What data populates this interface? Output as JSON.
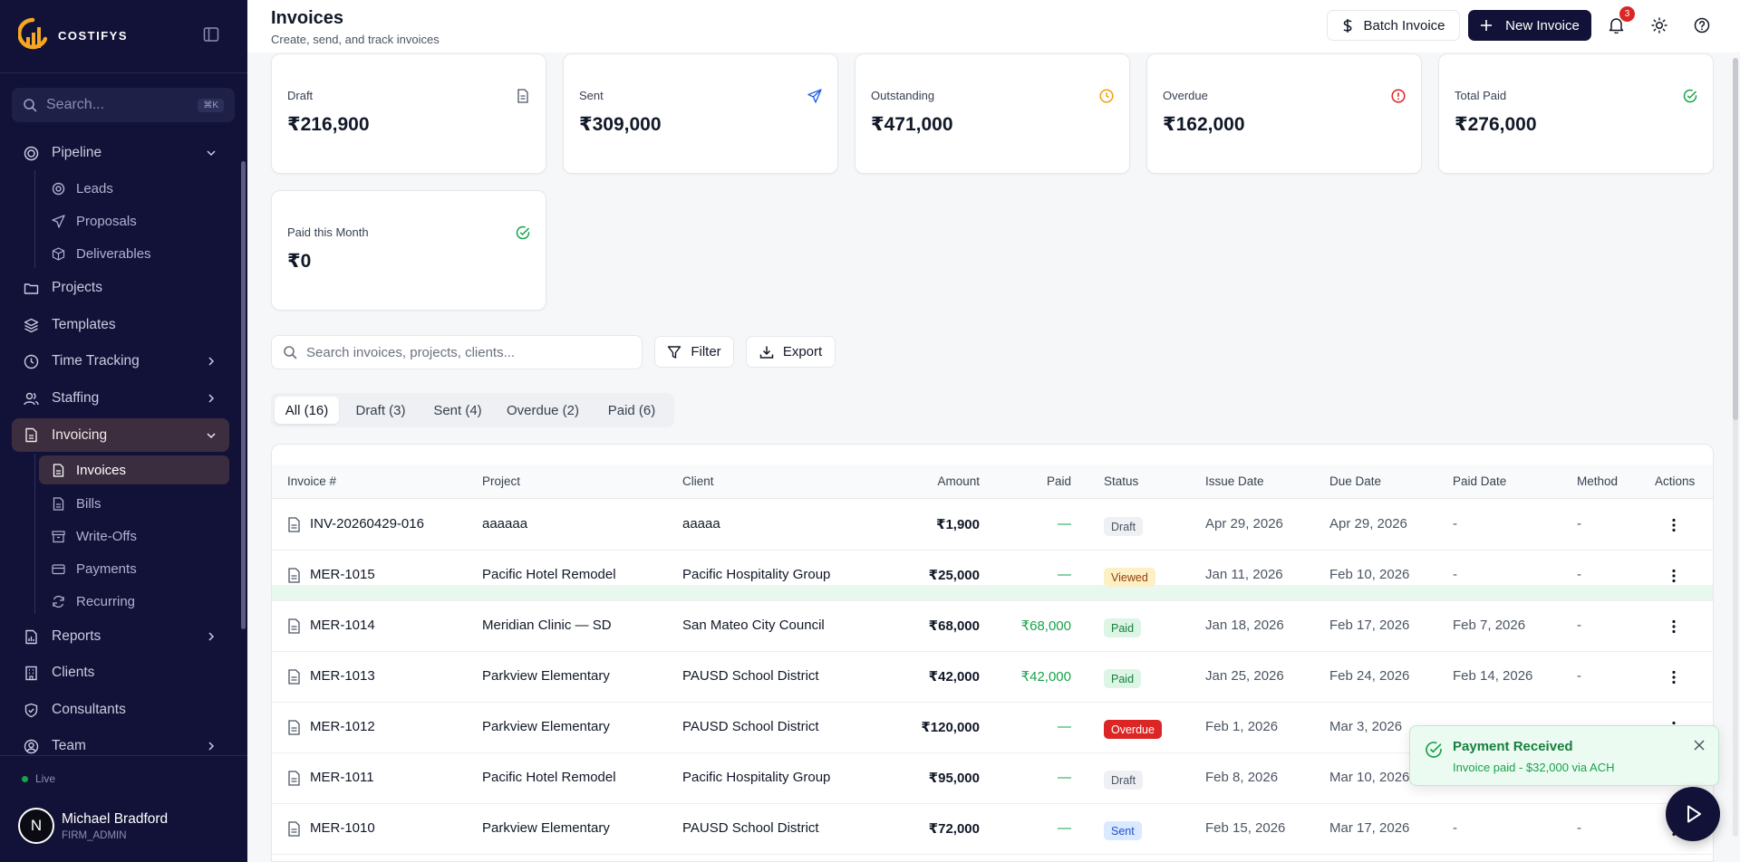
{
  "brand": {
    "name": "COSTIFYS"
  },
  "sidebar": {
    "search_placeholder": "Search...",
    "search_shortcut": "⌘K",
    "items": [
      {
        "label": "Pipeline"
      },
      {
        "label": "Leads"
      },
      {
        "label": "Proposals"
      },
      {
        "label": "Deliverables"
      },
      {
        "label": "Projects"
      },
      {
        "label": "Templates"
      },
      {
        "label": "Time Tracking"
      },
      {
        "label": "Staffing"
      },
      {
        "label": "Invoicing"
      },
      {
        "label": "Invoices"
      },
      {
        "label": "Bills"
      },
      {
        "label": "Write-Offs"
      },
      {
        "label": "Payments"
      },
      {
        "label": "Recurring"
      },
      {
        "label": "Reports"
      },
      {
        "label": "Clients"
      },
      {
        "label": "Consultants"
      },
      {
        "label": "Team"
      }
    ],
    "status": "Live",
    "user": {
      "initial": "N",
      "name": "Michael Bradford",
      "role": "FIRM_ADMIN"
    }
  },
  "header": {
    "title": "Invoices",
    "subtitle": "Create, send, and track invoices",
    "batch_label": "Batch Invoice",
    "new_label": "New Invoice",
    "notification_count": "3"
  },
  "cards": [
    {
      "label": "Draft",
      "value": "₹216,900"
    },
    {
      "label": "Sent",
      "value": "₹309,000"
    },
    {
      "label": "Outstanding",
      "value": "₹471,000"
    },
    {
      "label": "Overdue",
      "value": "₹162,000"
    },
    {
      "label": "Total Paid",
      "value": "₹276,000"
    },
    {
      "label": "Paid this Month",
      "value": "₹0"
    }
  ],
  "toolbar": {
    "search_placeholder": "Search invoices, projects, clients...",
    "filter_label": "Filter",
    "export_label": "Export"
  },
  "tabs": [
    "All (16)",
    "Draft (3)",
    "Sent (4)",
    "Overdue (2)",
    "Paid (6)"
  ],
  "table": {
    "headers": [
      "Invoice #",
      "Project",
      "Client",
      "Amount",
      "Paid",
      "Status",
      "Issue Date",
      "Due Date",
      "Paid Date",
      "Method",
      "Actions"
    ],
    "rows": [
      {
        "invoice": "INV-20260429-016",
        "project": "aaaaaa",
        "client": "aaaaa",
        "amount": "₹1,900",
        "paid": "—",
        "status": "Draft",
        "issue": "Apr 29, 2026",
        "due": "Apr 29, 2026",
        "paid_date": "-",
        "method": "-"
      },
      {
        "invoice": "MER-1015",
        "project": "Pacific Hotel Remodel",
        "client": "Pacific Hospitality Group",
        "amount": "₹25,000",
        "paid": "—",
        "status": "Viewed",
        "issue": "Jan 11, 2026",
        "due": "Feb 10, 2026",
        "paid_date": "-",
        "method": "-"
      },
      {
        "invoice": "MER-1014",
        "project": "Meridian Clinic — SD",
        "client": "San Mateo City Council",
        "amount": "₹68,000",
        "paid": "₹68,000",
        "status": "Paid",
        "issue": "Jan 18, 2026",
        "due": "Feb 17, 2026",
        "paid_date": "Feb 7, 2026",
        "method": "-"
      },
      {
        "invoice": "MER-1013",
        "project": "Parkview Elementary",
        "client": "PAUSD School District",
        "amount": "₹42,000",
        "paid": "₹42,000",
        "status": "Paid",
        "issue": "Jan 25, 2026",
        "due": "Feb 24, 2026",
        "paid_date": "Feb 14, 2026",
        "method": "-"
      },
      {
        "invoice": "MER-1012",
        "project": "Parkview Elementary",
        "client": "PAUSD School District",
        "amount": "₹120,000",
        "paid": "—",
        "status": "Overdue",
        "issue": "Feb 1, 2026",
        "due": "Mar 3, 2026",
        "paid_date": "",
        "method": ""
      },
      {
        "invoice": "MER-1011",
        "project": "Pacific Hotel Remodel",
        "client": "Pacific Hospitality Group",
        "amount": "₹95,000",
        "paid": "—",
        "status": "Draft",
        "issue": "Feb 8, 2026",
        "due": "Mar 10, 2026",
        "paid_date": "",
        "method": ""
      },
      {
        "invoice": "MER-1010",
        "project": "Parkview Elementary",
        "client": "PAUSD School District",
        "amount": "₹72,000",
        "paid": "—",
        "status": "Sent",
        "issue": "Feb 15, 2026",
        "due": "Mar 17, 2026",
        "paid_date": "-",
        "method": "-"
      }
    ]
  },
  "toast": {
    "title": "Payment Received",
    "message": "Invoice paid - $32,000 via ACH"
  },
  "colors": {
    "sidebar": "#121238",
    "accent": "#121238",
    "success": "#16a34a",
    "danger": "#dc2626",
    "warning": "#f59e0b",
    "info": "#2563eb"
  }
}
